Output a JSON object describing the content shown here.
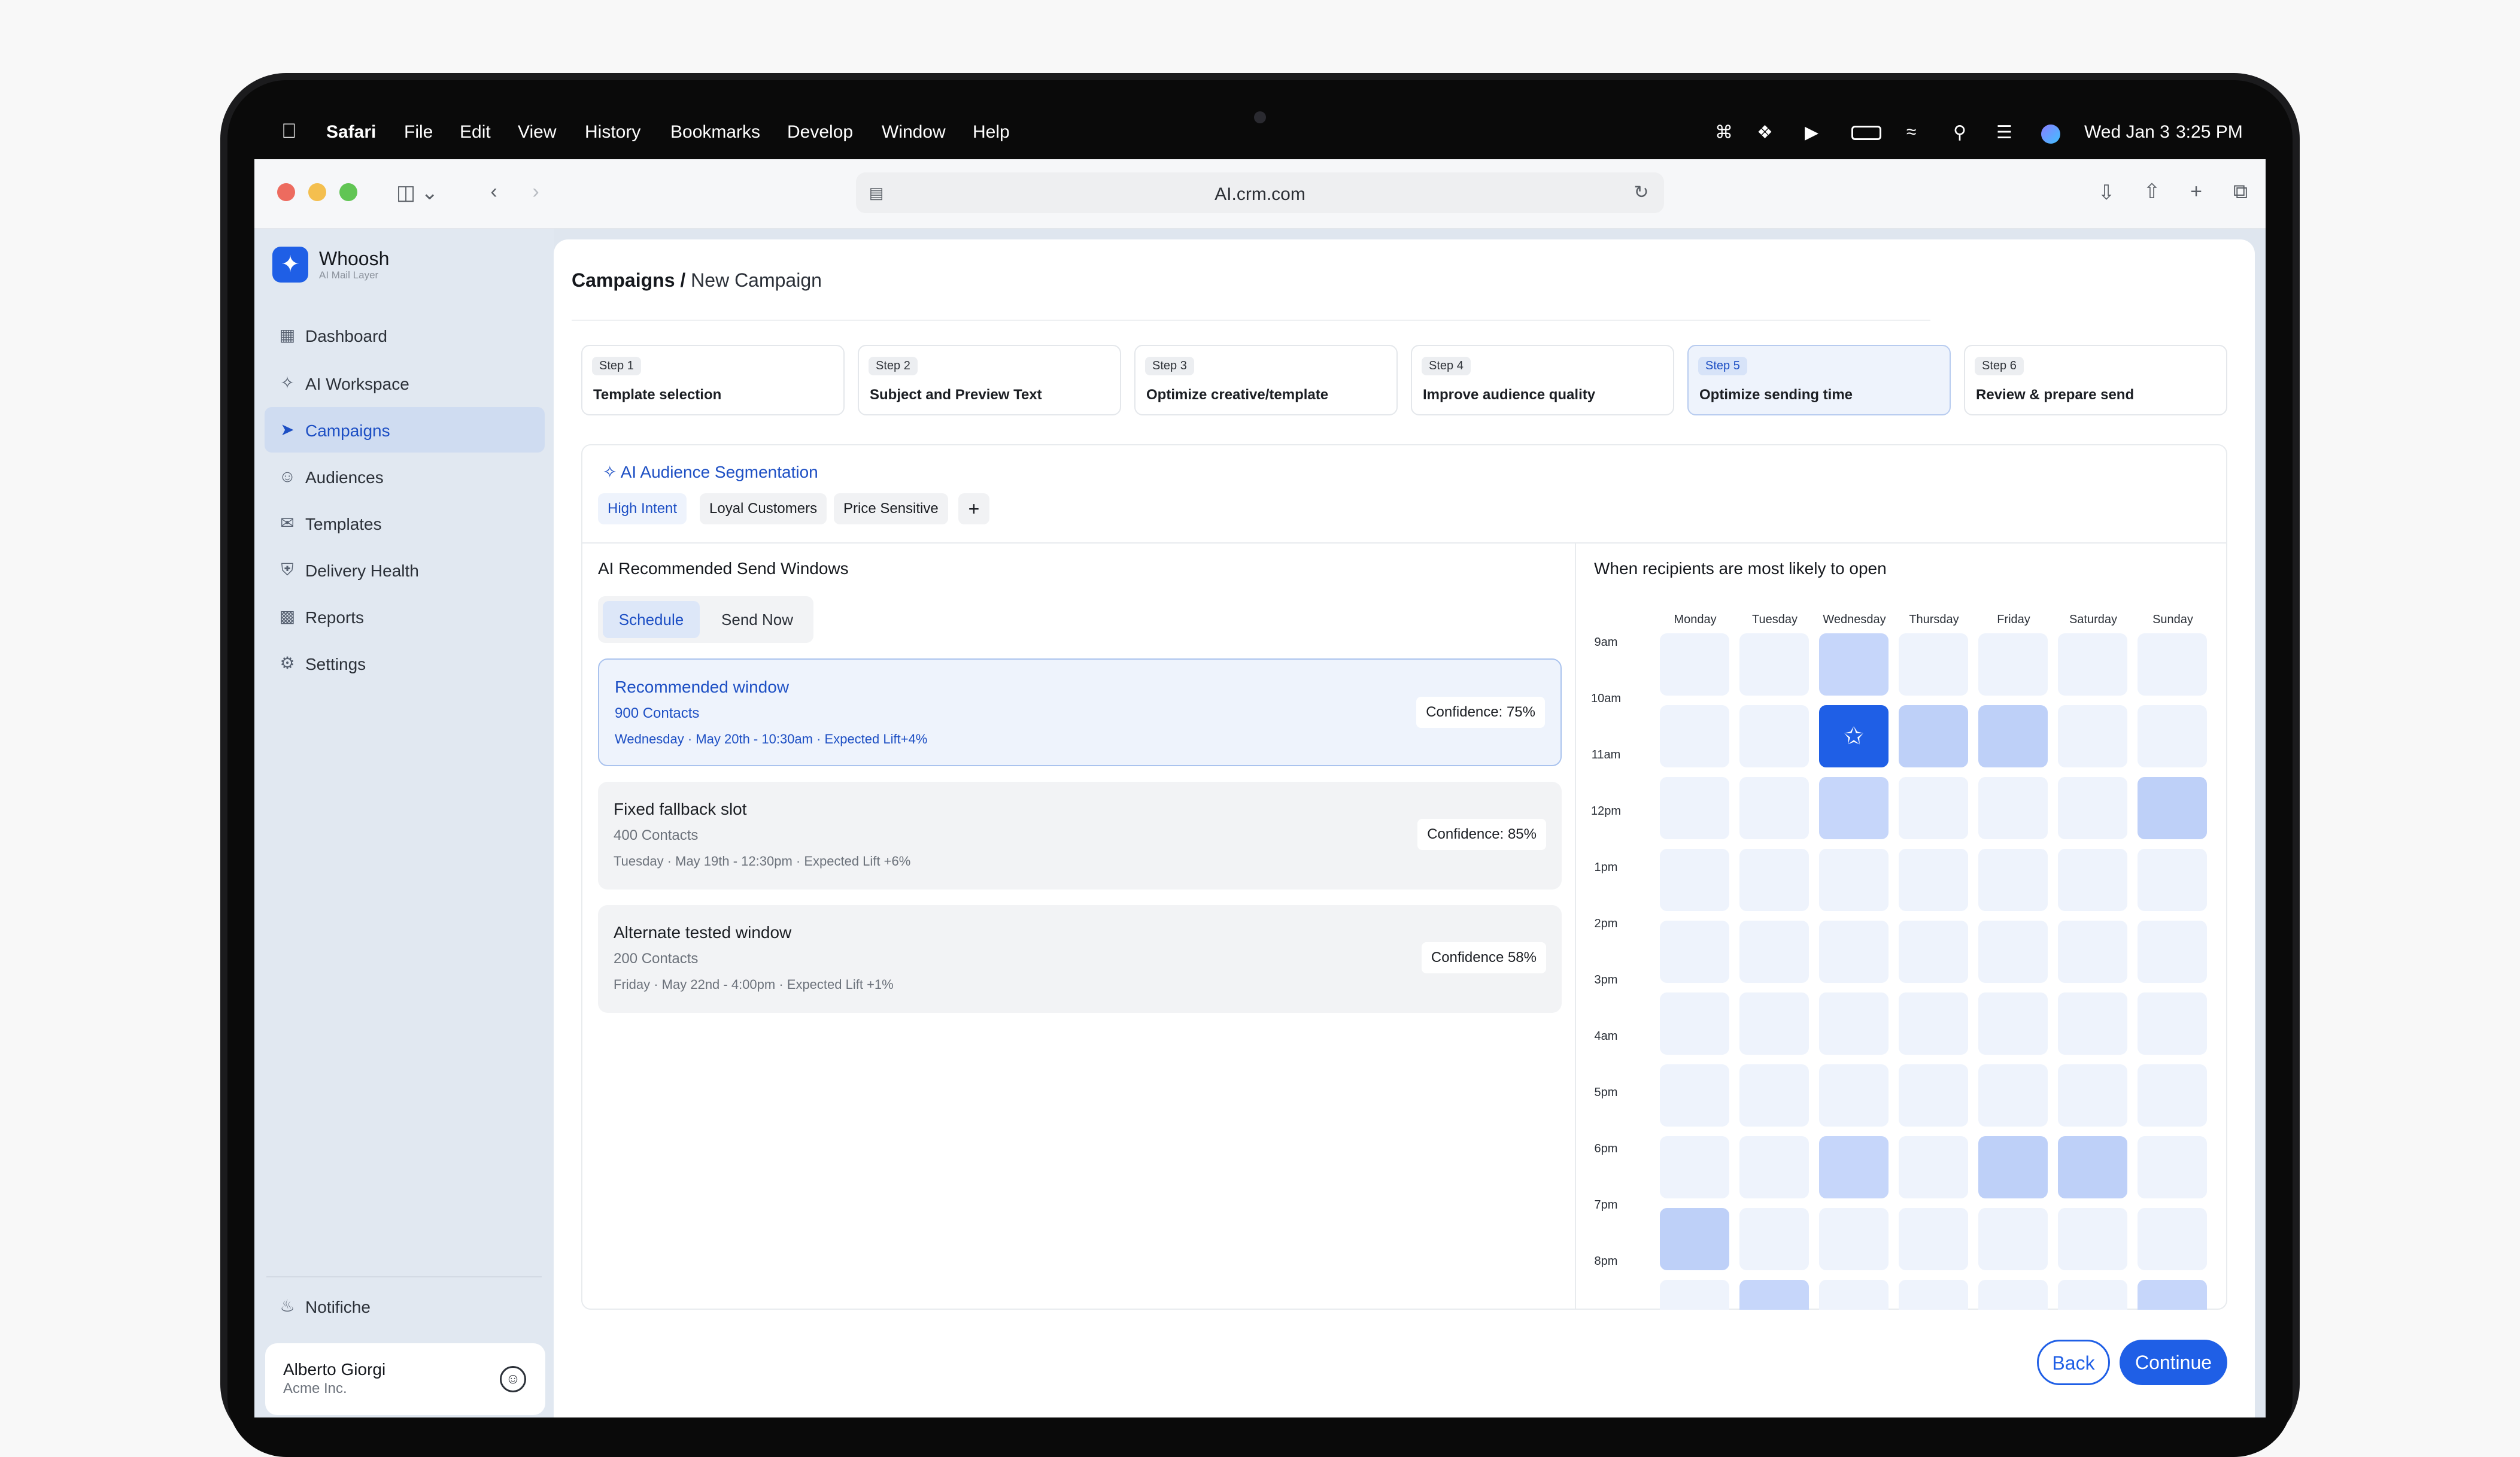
{
  "menubar": {
    "app_name": "Safari",
    "menus": [
      "File",
      "Edit",
      "View",
      "History",
      "Bookmarks",
      "Develop",
      "Window",
      "Help"
    ],
    "date": "Wed Jan 3",
    "time": "3:25 PM",
    "status_icons": [
      "keyboard-icon",
      "airdrop-icon",
      "play-icon",
      "battery-icon",
      "wifi-icon",
      "search-icon",
      "control-center-icon",
      "siri-icon"
    ]
  },
  "browser": {
    "url": "AI.crm.com"
  },
  "sidebar": {
    "brand_name": "Whoosh",
    "brand_tagline": "AI Mail Layer",
    "items": [
      {
        "label": "Dashboard",
        "icon": "dashboard-icon"
      },
      {
        "label": "AI Workspace",
        "icon": "sparkles-icon"
      },
      {
        "label": "Campaigns",
        "icon": "send-icon",
        "active": true
      },
      {
        "label": "Audiences",
        "icon": "users-icon"
      },
      {
        "label": "Templates",
        "icon": "mail-icon"
      },
      {
        "label": "Delivery Health",
        "icon": "shield-icon"
      },
      {
        "label": "Reports",
        "icon": "bar-chart-icon"
      },
      {
        "label": "Settings",
        "icon": "gear-icon"
      }
    ],
    "notifications_label": "Notifiche",
    "user": {
      "name": "Alberto Giorgi",
      "company": "Acme Inc."
    }
  },
  "breadcrumb": {
    "parent": "Campaigns /",
    "current": "New Campaign"
  },
  "steps": [
    {
      "tag": "Step 1",
      "title": "Template selection"
    },
    {
      "tag": "Step 2",
      "title": "Subject and Preview Text"
    },
    {
      "tag": "Step 3",
      "title": "Optimize creative/template"
    },
    {
      "tag": "Step 4",
      "title": "Improve audience quality"
    },
    {
      "tag": "Step 5",
      "title": "Optimize sending time",
      "active": true
    },
    {
      "tag": "Step 6",
      "title": "Review & prepare send"
    }
  ],
  "segmentation": {
    "title": "AI Audience Segmentation",
    "chips": [
      "High Intent",
      "Loyal Customers",
      "Price Sensitive"
    ],
    "add_label": "+"
  },
  "send_windows": {
    "title": "AI Recommended Send Windows",
    "tabs": [
      "Schedule",
      "Send Now"
    ],
    "windows": [
      {
        "title": "Recommended window",
        "contacts": "900 Contacts",
        "meta": "Wednesday · May 20th - 10:30am · Expected Lift+4%",
        "confidence": "Confidence: 75%"
      },
      {
        "title": "Fixed fallback slot",
        "contacts": "400 Contacts",
        "meta": "Tuesday · May 19th - 12:30pm · Expected Lift +6%",
        "confidence": "Confidence: 85%"
      },
      {
        "title": "Alternate tested window",
        "contacts": "200 Contacts",
        "meta": "Friday · May 22nd - 4:00pm · Expected Lift +1%",
        "confidence": "Confidence 58%"
      }
    ]
  },
  "heatmap": {
    "title": "When recipients are most likely to open",
    "days": [
      "Monday",
      "Tuesday",
      "Wednesday",
      "Thursday",
      "Friday",
      "Saturday",
      "Sunday"
    ],
    "hours": [
      "9am",
      "10am",
      "11am",
      "12pm",
      "1pm",
      "2pm",
      "3pm",
      "4am",
      "5pm",
      "6pm",
      "7pm",
      "8pm"
    ],
    "levels": [
      [
        0,
        0,
        1,
        0,
        0,
        0,
        0
      ],
      [
        0,
        0,
        3,
        2,
        2,
        0,
        0
      ],
      [
        0,
        0,
        1,
        0,
        0,
        0,
        2
      ],
      [
        0,
        0,
        0,
        0,
        0,
        0,
        0
      ],
      [
        0,
        0,
        0,
        0,
        0,
        0,
        0
      ],
      [
        0,
        0,
        0,
        0,
        0,
        0,
        0
      ],
      [
        0,
        0,
        0,
        0,
        0,
        0,
        0
      ],
      [
        0,
        0,
        1,
        0,
        2,
        2,
        0
      ],
      [
        2,
        0,
        0,
        0,
        0,
        0,
        0
      ],
      [
        0,
        1,
        0,
        0,
        0,
        0,
        1
      ]
    ],
    "top_icon": "star-icon"
  },
  "actions": {
    "back": "Back",
    "continue": "Continue"
  }
}
